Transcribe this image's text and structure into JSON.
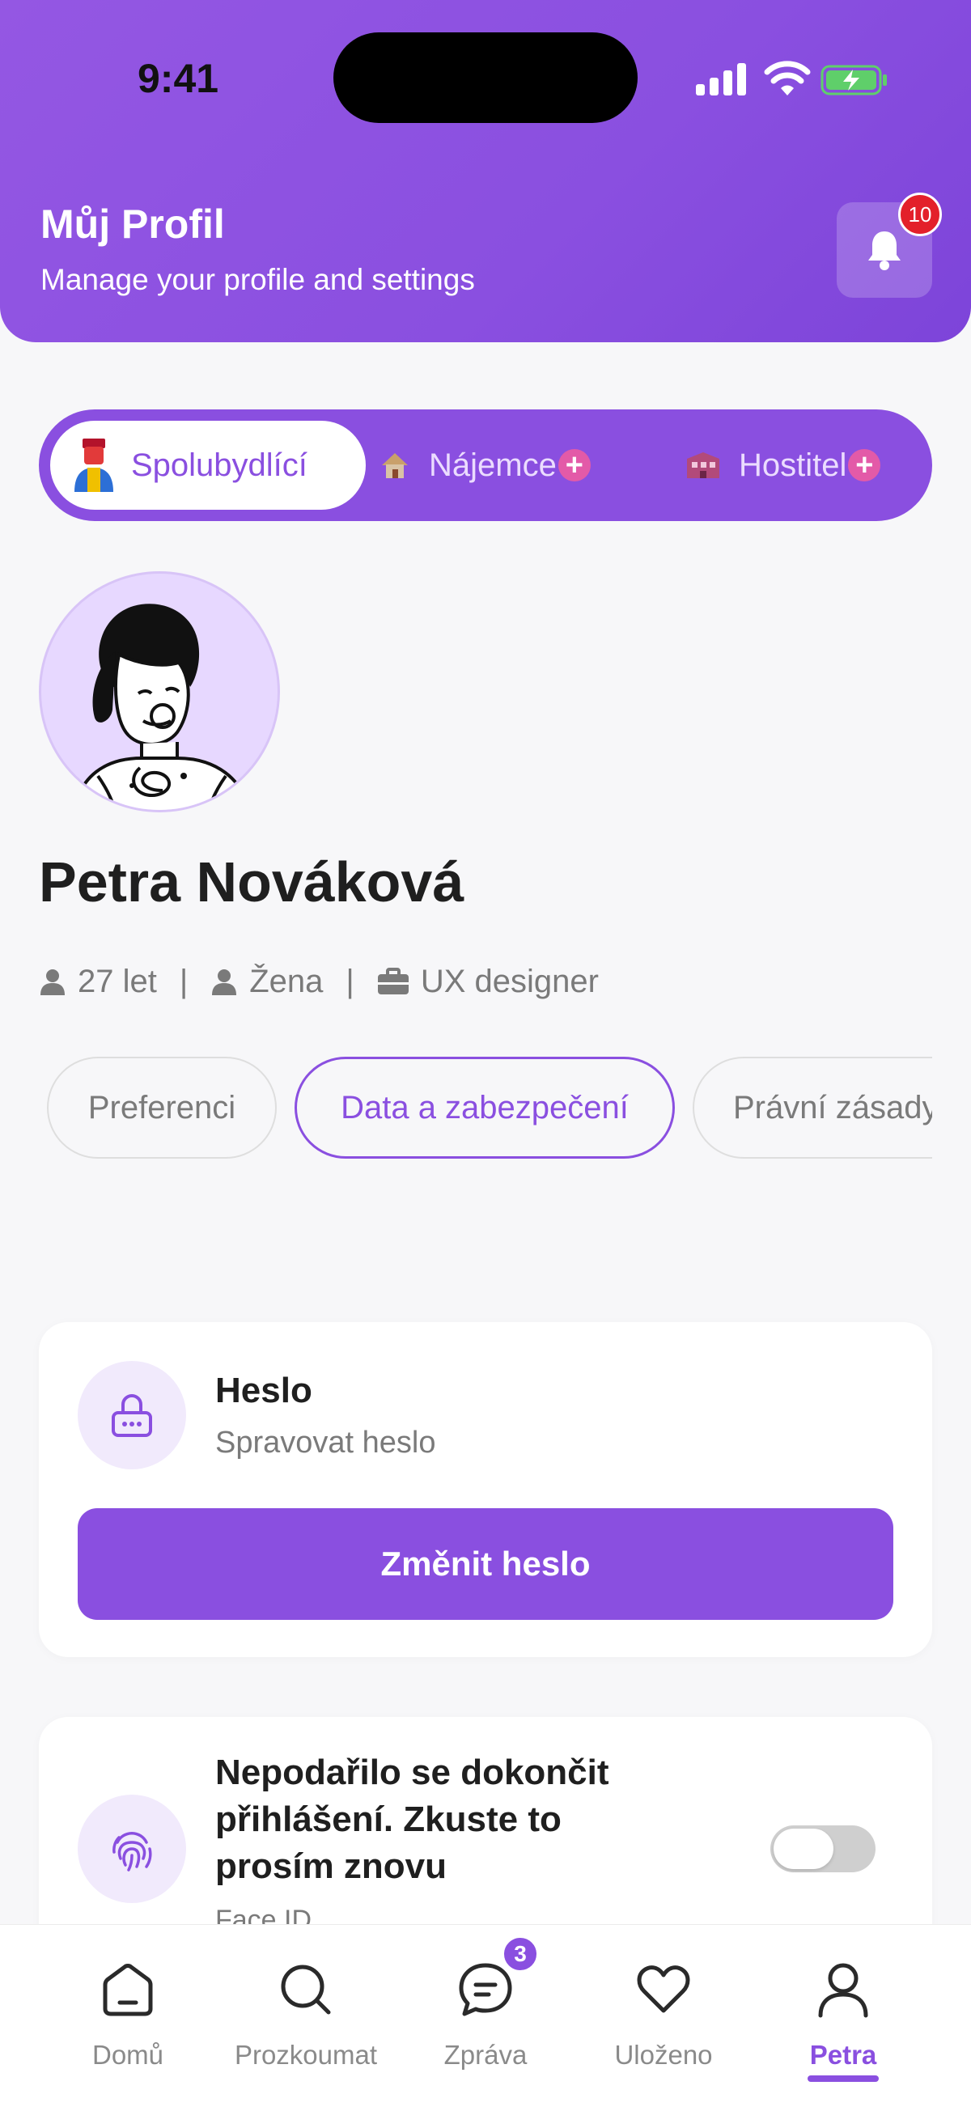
{
  "status_bar": {
    "time": "9:41"
  },
  "header": {
    "title": "Můj Profil",
    "subtitle": "Manage your profile and settings",
    "notification_count": "10"
  },
  "roles": [
    {
      "label": "Spolubydlící",
      "icon": "roommate-person-icon",
      "active": true
    },
    {
      "label": "Nájemce",
      "icon": "house-icon",
      "plus": "+"
    },
    {
      "label": "Hostitel",
      "icon": "building-icon",
      "plus": "+"
    }
  ],
  "profile": {
    "name": "Petra Nováková",
    "age": "27 let",
    "gender": "Žena",
    "job": "UX designer",
    "separator": "|"
  },
  "tabs": [
    {
      "label": "Preferenci",
      "active": false
    },
    {
      "label": "Data a zabezpečení",
      "active": true
    },
    {
      "label": "Právní zásady",
      "active": false
    }
  ],
  "password_card": {
    "title": "Heslo",
    "subtitle": "Spravovat heslo",
    "button": "Změnit heslo"
  },
  "faceid_card": {
    "title": "Nepodařilo se dokončit přihlášení. Zkuste to prosím znovu",
    "subtitle": "Face ID",
    "toggle_on": false
  },
  "bottom_nav": [
    {
      "label": "Domů",
      "icon": "home-icon"
    },
    {
      "label": "Prozkoumat",
      "icon": "search-icon"
    },
    {
      "label": "Zpráva",
      "icon": "chat-icon",
      "badge": "3"
    },
    {
      "label": "Uloženo",
      "icon": "heart-icon"
    },
    {
      "label": "Petra",
      "icon": "user-icon",
      "active": true
    }
  ],
  "colors": {
    "brand": "#8a4fe0",
    "header_gradient_start": "#9457e3",
    "badge_red": "#e3202a",
    "background": "#f7f7f9"
  }
}
